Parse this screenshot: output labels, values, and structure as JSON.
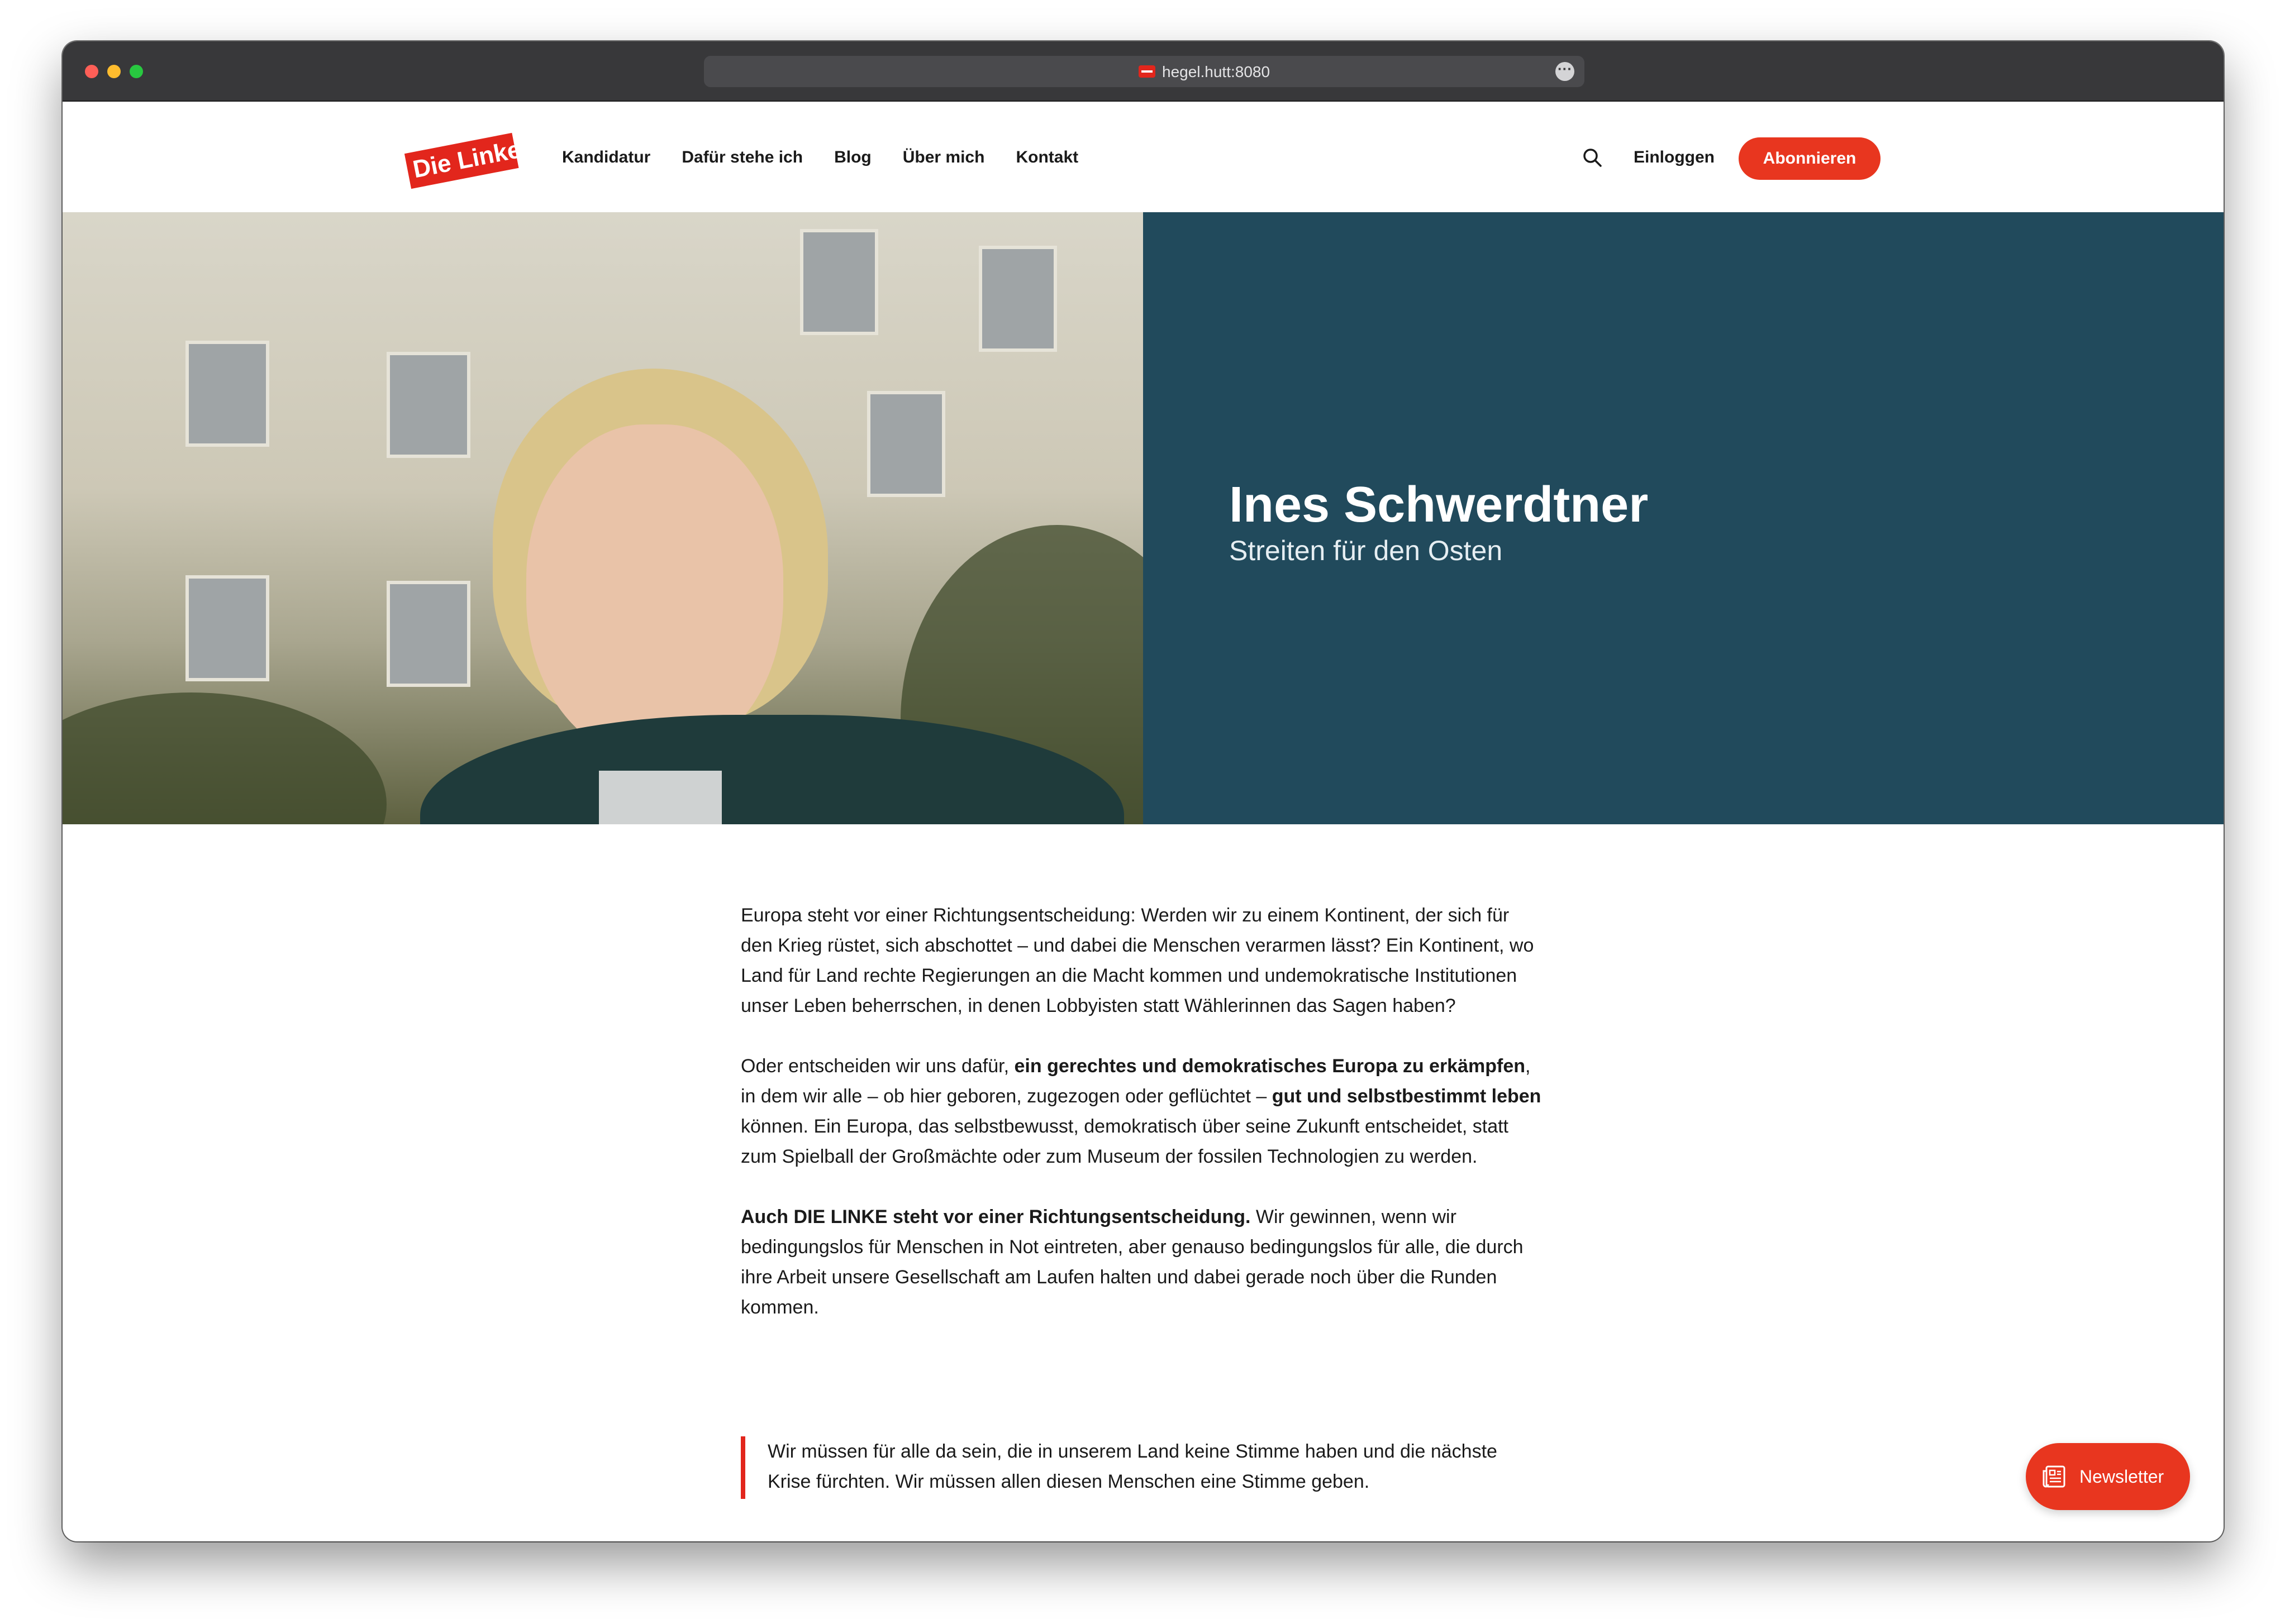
{
  "browser": {
    "url": "hegel.hutt:8080",
    "more_icon": "ellipsis-icon"
  },
  "nav": {
    "logo_text": "Die Linke",
    "links": [
      "Kandidatur",
      "Dafür stehe ich",
      "Blog",
      "Über mich",
      "Kontakt"
    ],
    "search_icon": "search-icon",
    "login_label": "Einloggen",
    "subscribe_label": "Abonnieren"
  },
  "hero": {
    "title": "Ines Schwerdtner",
    "subtitle": "Streiten für den Osten",
    "panel_color": "#214a5c"
  },
  "content": {
    "p1": "Europa steht vor einer Richtungsentscheidung: Werden wir zu einem Kontinent, der sich für den Krieg rüstet, sich abschottet – und dabei die Menschen verarmen lässt? Ein Kontinent, wo Land für Land rechte Regierungen an die Macht kommen und undemokratische Institutionen unser Leben beherrschen, in denen Lobbyisten statt Wählerinnen das Sagen haben?",
    "p2_a": "Oder entscheiden wir uns dafür, ",
    "p2_b": "ein gerechtes und demokratisches Europa zu erkämpfen",
    "p2_c": ", in dem wir alle – ob hier geboren, zugezogen oder geflüchtet – ",
    "p2_d": "gut und selbstbestimmt leben",
    "p2_e": " können. Ein Europa, das selbstbewusst, demokratisch über seine Zukunft entscheidet, statt zum Spielball der Großmächte oder zum Museum der fossilen Technologien zu werden.",
    "p3_a": "Auch DIE LINKE steht vor einer Richtungsentscheidung.",
    "p3_b": " Wir gewinnen, wenn wir bedingungslos für Menschen in Not eintreten, aber genauso bedingungslos für alle, die durch ihre Arbeit unsere Gesellschaft am Laufen halten und dabei gerade noch über die Runden kommen.",
    "quote": "Wir müssen für alle da sein, die in unserem Land keine Stimme haben und die nächste Krise fürchten. Wir müssen allen diesen Menschen eine Stimme geben."
  },
  "newsletter": {
    "label": "Newsletter",
    "icon": "newspaper-icon"
  },
  "colors": {
    "brand_red": "#e2261c",
    "button_red": "#e8361f",
    "hero_panel": "#214a5c"
  }
}
